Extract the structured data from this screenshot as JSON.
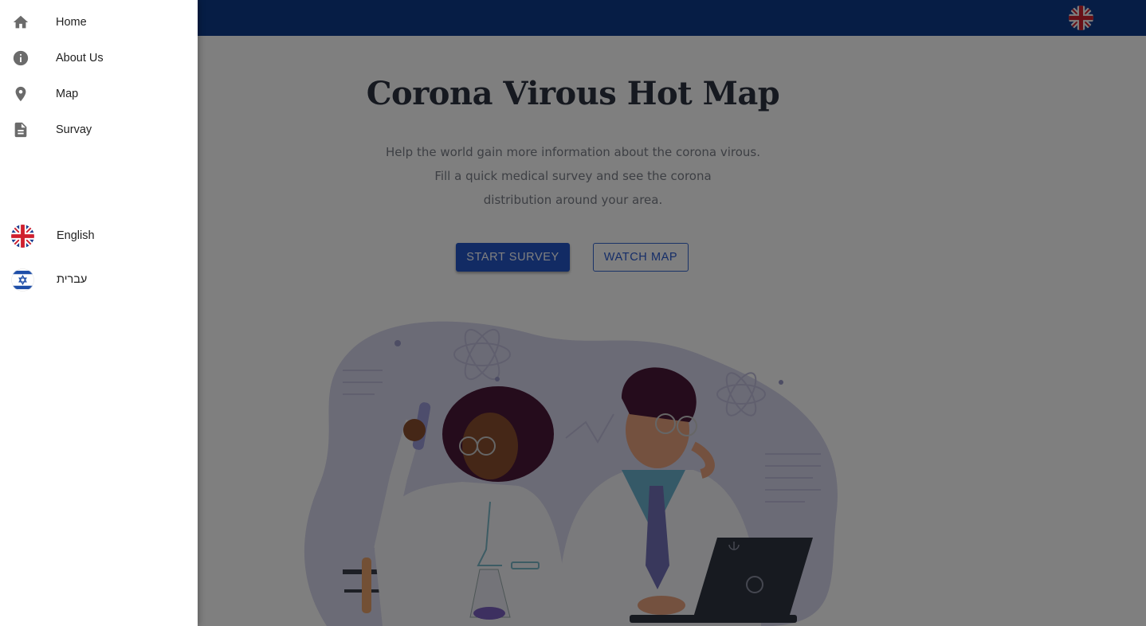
{
  "header": {
    "language_icon": "uk-flag-icon",
    "bar_color": "#0d3a8a"
  },
  "hero": {
    "title": "Corona Virous Hot Map",
    "subtitle_lines": [
      "Help the world gain more information about the corona virous.",
      "Fill a quick medical survey and see the corona",
      "distribution around your area."
    ],
    "primary_button": "START SURVEY",
    "secondary_button": "WATCH MAP"
  },
  "drawer": {
    "nav_items": [
      {
        "label": "Home",
        "icon": "home-icon"
      },
      {
        "label": "About Us",
        "icon": "info-icon"
      },
      {
        "label": "Map",
        "icon": "location-pin-icon"
      },
      {
        "label": "Survay",
        "icon": "document-icon"
      }
    ],
    "languages": [
      {
        "label": "English",
        "icon": "uk-flag-icon"
      },
      {
        "label": "עברית",
        "icon": "israel-flag-icon"
      }
    ]
  },
  "colors": {
    "primary": "#2557c8",
    "appbar": "#0d3a8a",
    "scrim": "rgba(0,0,0,0.5)"
  }
}
